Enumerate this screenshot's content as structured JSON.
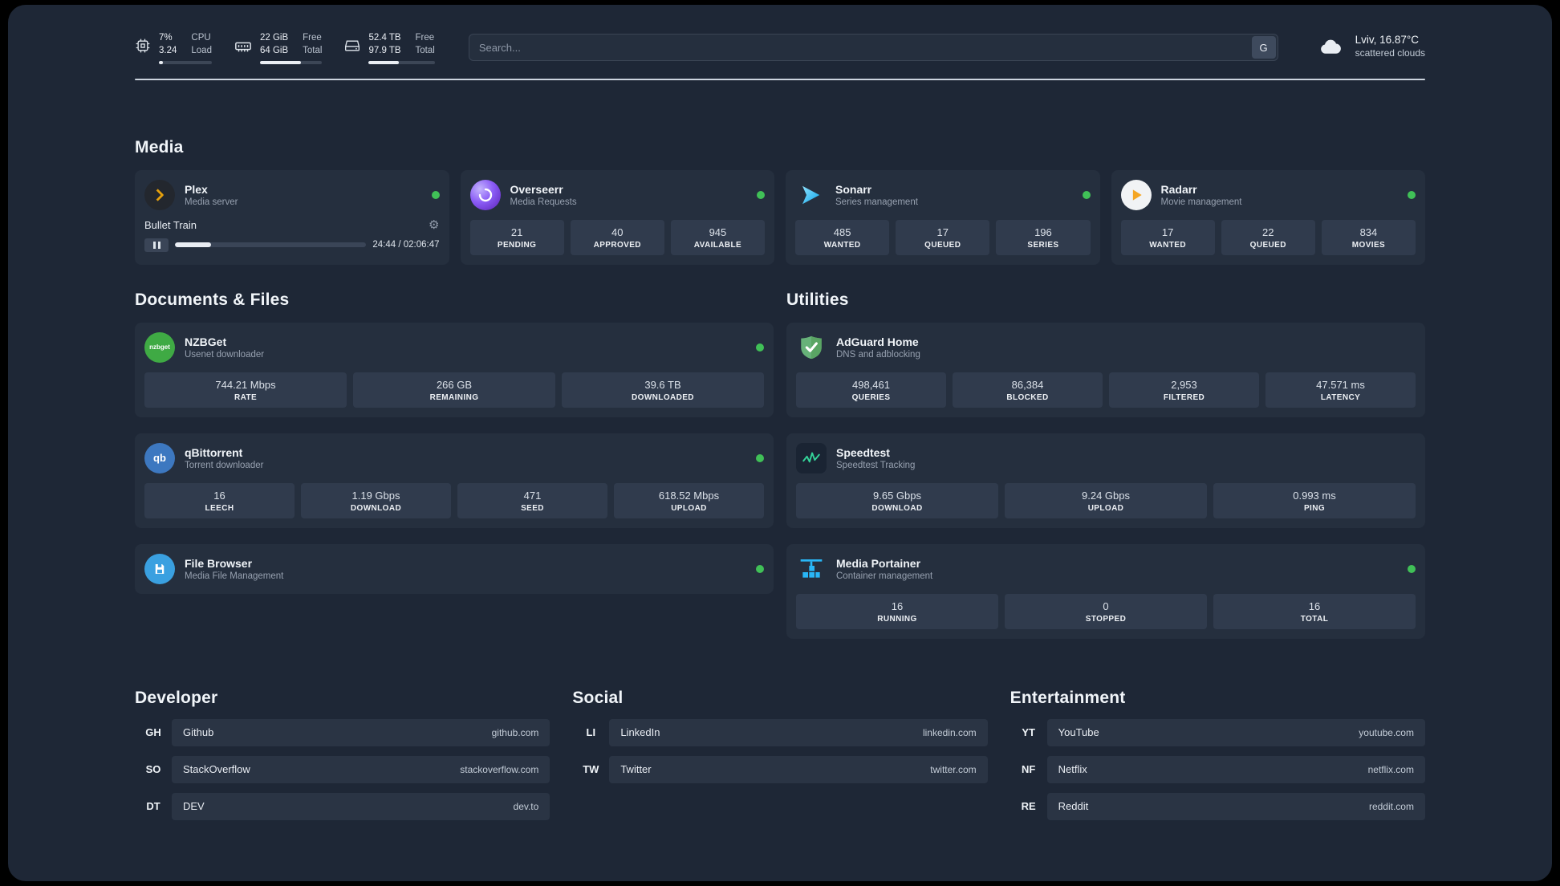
{
  "colors": {
    "status_online": "#40c057",
    "plex_accent": "#e5a00d",
    "overseerr_accent": "#8b5cf6",
    "sonarr_accent": "#35c5f4",
    "radarr_accent": "#f5a623",
    "nzbget_accent": "#3faa44",
    "qbittorrent_accent": "#3d78c0",
    "filebrowser_accent": "#3aa0e0",
    "adguard_accent": "#67b279",
    "speedtest_accent": "#34d399",
    "portainer_accent": "#29b6f6"
  },
  "topbar": {
    "cpu": {
      "value_top": "7%",
      "value_bottom": "3.24",
      "label_top": "CPU",
      "label_bottom": "Load",
      "bar_percent": 7
    },
    "ram": {
      "value_top": "22 GiB",
      "value_bottom": "64 GiB",
      "label_top": "Free",
      "label_bottom": "Total",
      "bar_percent": 66
    },
    "disk": {
      "value_top": "52.4 TB",
      "value_bottom": "97.9 TB",
      "label_top": "Free",
      "label_bottom": "Total",
      "bar_percent": 46
    },
    "search": {
      "placeholder": "Search...",
      "button_label": "G"
    },
    "weather": {
      "location": "Lviv, 16.87°C",
      "condition": "scattered clouds"
    }
  },
  "sections": {
    "media": "Media",
    "documents": "Documents & Files",
    "utilities": "Utilities",
    "developer": "Developer",
    "social": "Social",
    "entertainment": "Entertainment"
  },
  "media_cards": [
    {
      "name": "Plex",
      "desc": "Media server",
      "player": {
        "title": "Bullet Train",
        "time": "24:44 / 02:06:47",
        "progress_percent": 19
      }
    },
    {
      "name": "Overseerr",
      "desc": "Media Requests",
      "stats": [
        {
          "value": "21",
          "label": "PENDING"
        },
        {
          "value": "40",
          "label": "APPROVED"
        },
        {
          "value": "945",
          "label": "AVAILABLE"
        }
      ]
    },
    {
      "name": "Sonarr",
      "desc": "Series management",
      "stats": [
        {
          "value": "485",
          "label": "WANTED"
        },
        {
          "value": "17",
          "label": "QUEUED"
        },
        {
          "value": "196",
          "label": "SERIES"
        }
      ]
    },
    {
      "name": "Radarr",
      "desc": "Movie management",
      "stats": [
        {
          "value": "17",
          "label": "WANTED"
        },
        {
          "value": "22",
          "label": "QUEUED"
        },
        {
          "value": "834",
          "label": "MOVIES"
        }
      ]
    }
  ],
  "documents_cards": [
    {
      "name": "NZBGet",
      "desc": "Usenet downloader",
      "icon_text": "nzbget",
      "stats": [
        {
          "value": "744.21 Mbps",
          "label": "RATE"
        },
        {
          "value": "266 GB",
          "label": "REMAINING"
        },
        {
          "value": "39.6 TB",
          "label": "DOWNLOADED"
        }
      ]
    },
    {
      "name": "qBittorrent",
      "desc": "Torrent downloader",
      "icon_text": "qb",
      "stats": [
        {
          "value": "16",
          "label": "LEECH"
        },
        {
          "value": "1.19 Gbps",
          "label": "DOWNLOAD"
        },
        {
          "value": "471",
          "label": "SEED"
        },
        {
          "value": "618.52 Mbps",
          "label": "UPLOAD"
        }
      ]
    },
    {
      "name": "File Browser",
      "desc": "Media File Management"
    }
  ],
  "utilities_cards": [
    {
      "name": "AdGuard Home",
      "desc": "DNS and adblocking",
      "stats": [
        {
          "value": "498,461",
          "label": "QUERIES"
        },
        {
          "value": "86,384",
          "label": "BLOCKED"
        },
        {
          "value": "2,953",
          "label": "FILTERED"
        },
        {
          "value": "47.571 ms",
          "label": "LATENCY"
        }
      ]
    },
    {
      "name": "Speedtest",
      "desc": "Speedtest Tracking",
      "stats": [
        {
          "value": "9.65 Gbps",
          "label": "DOWNLOAD"
        },
        {
          "value": "9.24 Gbps",
          "label": "UPLOAD"
        },
        {
          "value": "0.993 ms",
          "label": "PING"
        }
      ]
    },
    {
      "name": "Media Portainer",
      "desc": "Container management",
      "stats": [
        {
          "value": "16",
          "label": "RUNNING"
        },
        {
          "value": "0",
          "label": "STOPPED"
        },
        {
          "value": "16",
          "label": "TOTAL"
        }
      ]
    }
  ],
  "bookmarks": {
    "developer": [
      {
        "abbr": "GH",
        "name": "Github",
        "url": "github.com"
      },
      {
        "abbr": "SO",
        "name": "StackOverflow",
        "url": "stackoverflow.com"
      },
      {
        "abbr": "DT",
        "name": "DEV",
        "url": "dev.to"
      }
    ],
    "social": [
      {
        "abbr": "LI",
        "name": "LinkedIn",
        "url": "linkedin.com"
      },
      {
        "abbr": "TW",
        "name": "Twitter",
        "url": "twitter.com"
      }
    ],
    "entertainment": [
      {
        "abbr": "YT",
        "name": "YouTube",
        "url": "youtube.com"
      },
      {
        "abbr": "NF",
        "name": "Netflix",
        "url": "netflix.com"
      },
      {
        "abbr": "RE",
        "name": "Reddit",
        "url": "reddit.com"
      }
    ]
  }
}
